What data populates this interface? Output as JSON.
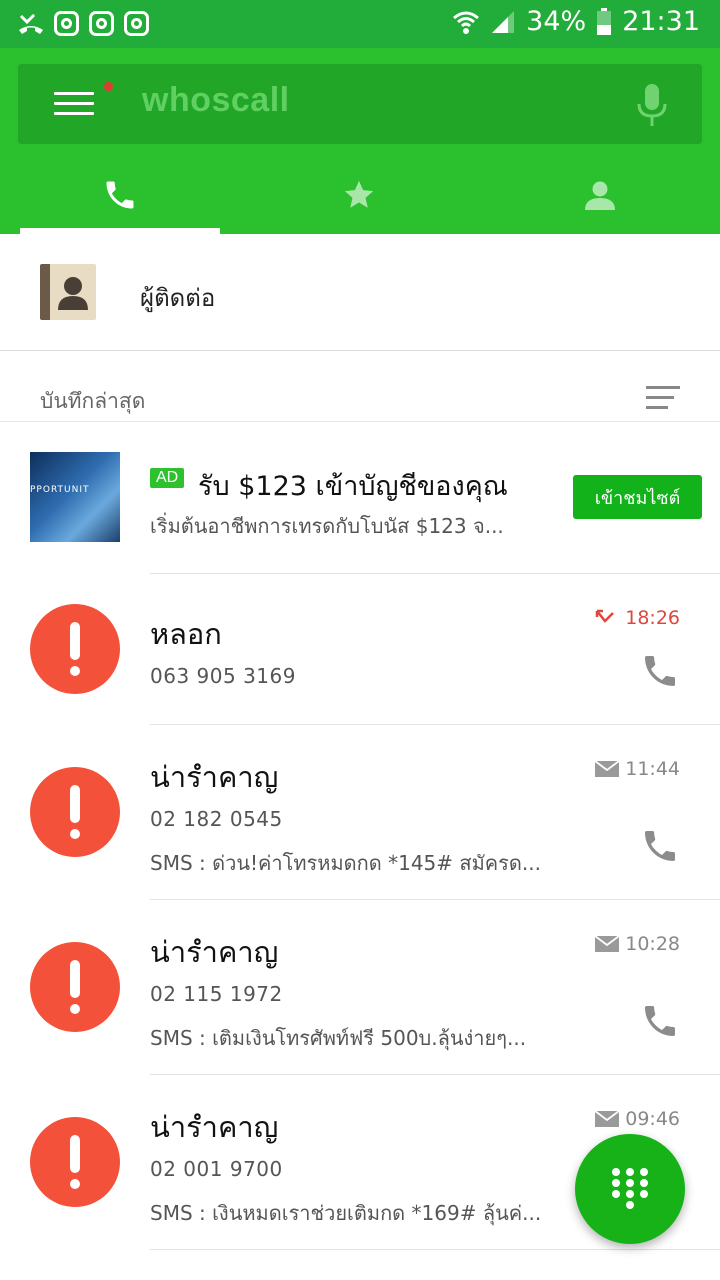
{
  "status_bar": {
    "battery": "34%",
    "time": "21:31"
  },
  "search": {
    "placeholder": "whoscall"
  },
  "contacts": {
    "label": "ผู้ติดต่อ"
  },
  "recent": {
    "title": "บันทึกล่าสุด"
  },
  "ad": {
    "badge": "AD",
    "image_text": "PPORTUNIT",
    "title": "รับ $123 เข้าบัญชีของคุณ",
    "description": "เริ่มต้นอาชีพการเทรดกับโบนัส $123 จ...",
    "button": "เข้าชมไซต์"
  },
  "calls": [
    {
      "name": "หลอก",
      "number": "063 905 3169",
      "sms": "",
      "time": "18:26",
      "type": "missed"
    },
    {
      "name": "น่ารำคาญ",
      "number": "02 182 0545",
      "sms": "SMS : ด่วน!ค่าโทรหมดกด *145# สมัครด...",
      "time": "11:44",
      "type": "sms"
    },
    {
      "name": "น่ารำคาญ",
      "number": "02 115 1972",
      "sms": "SMS : เติมเงินโทรศัพท์ฟรี 500บ.ลุ้นง่ายๆ...",
      "time": "10:28",
      "type": "sms"
    },
    {
      "name": "น่ารำคาญ",
      "number": "02 001 9700",
      "sms": "SMS : เงินหมดเราช่วยเติมกด *169# ลุ้นค่...",
      "time": "09:46",
      "type": "sms"
    }
  ],
  "colors": {
    "status_bar": "#22ad3a",
    "app_bar": "#2bc02e",
    "search_box": "#22a627",
    "alert": "#f4513a",
    "missed_time": "#e0463b",
    "fab": "#16b218"
  },
  "icons": [
    "missed-call-status-icon",
    "instagram-icon",
    "wifi-icon",
    "signal-icon",
    "battery-icon",
    "menu-icon",
    "mic-icon",
    "phone-tab-icon",
    "star-tab-icon",
    "person-tab-icon",
    "address-book-icon",
    "sort-icon",
    "missed-call-icon",
    "sms-icon",
    "phone-call-icon",
    "dialpad-icon"
  ]
}
